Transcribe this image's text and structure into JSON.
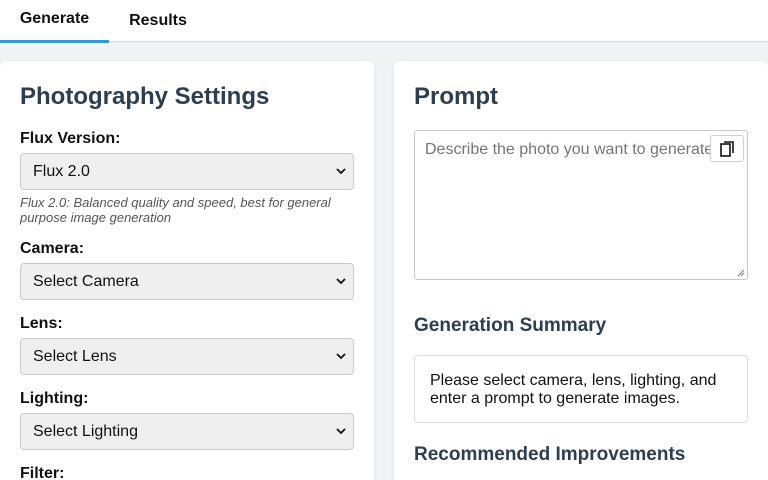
{
  "tabs": [
    {
      "label": "Generate",
      "active": true
    },
    {
      "label": "Results",
      "active": false
    }
  ],
  "settings": {
    "title": "Photography Settings",
    "flux_label": "Flux Version:",
    "flux_value": "Flux 2.0",
    "flux_hint": "Flux 2.0: Balanced quality and speed, best for general purpose image generation",
    "camera_label": "Camera:",
    "camera_value": "Select Camera",
    "lens_label": "Lens:",
    "lens_value": "Select Lens",
    "lighting_label": "Lighting:",
    "lighting_value": "Select Lighting",
    "filter_label": "Filter:"
  },
  "prompt": {
    "title": "Prompt",
    "placeholder": "Describe the photo you want to generate..."
  },
  "summary": {
    "title": "Generation Summary",
    "text": "Please select camera, lens, lighting, and enter a prompt to generate images."
  },
  "improvements": {
    "title": "Recommended Improvements"
  },
  "colors": {
    "accent": "#3498db",
    "heading": "#2c3e50"
  }
}
